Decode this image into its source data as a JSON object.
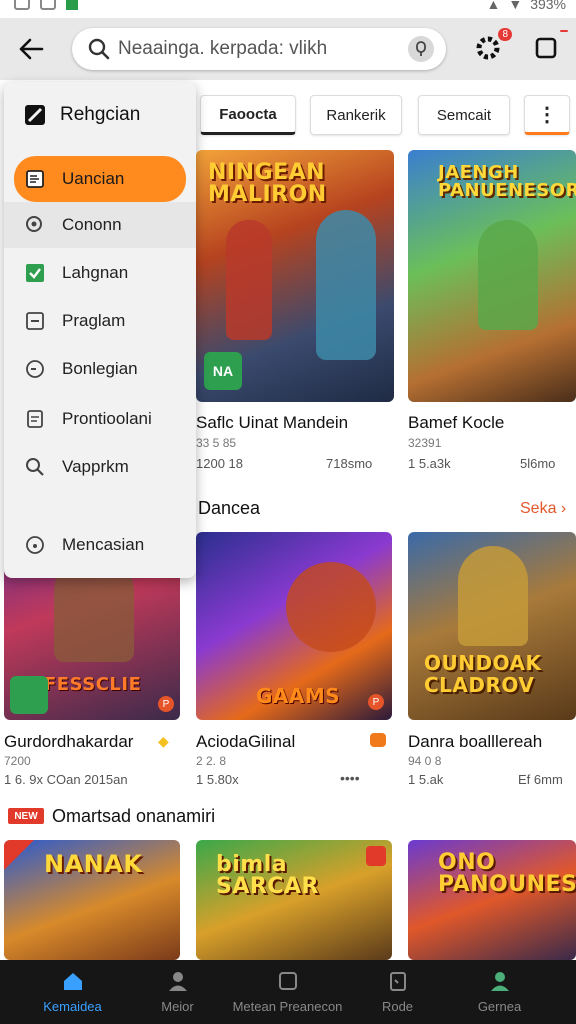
{
  "status_bar": {
    "battery_text": "393%"
  },
  "top_bar": {
    "search_placeholder": "Neaainga. kerpada: vlikh",
    "notif_badge": "8"
  },
  "chips": [
    {
      "label": "Faoocta",
      "active": true
    },
    {
      "label": "Rankerik",
      "active": false
    },
    {
      "label": "Semcait",
      "active": false
    },
    {
      "label": "⋮",
      "active": false
    }
  ],
  "drawer": {
    "title": "Rehgcian",
    "items": [
      {
        "label": "Uancian",
        "icon": "document-icon",
        "state": "active"
      },
      {
        "label": "Cononn",
        "icon": "search-circle-icon",
        "state": "highlight"
      },
      {
        "label": "Lahgnan",
        "icon": "checkbox-icon",
        "state": ""
      },
      {
        "label": "Praglam",
        "icon": "minus-box-icon",
        "state": ""
      },
      {
        "label": "Bonlegian",
        "icon": "clock-icon",
        "state": ""
      },
      {
        "label": "Prontioolani",
        "icon": "file-icon",
        "state": ""
      },
      {
        "label": "Vapprkm",
        "icon": "magnifier-icon",
        "state": ""
      },
      {
        "label": "Mencasian",
        "icon": "info-circle-icon",
        "state": ""
      }
    ]
  },
  "featured": [
    {
      "art_title": "NINGEAN MALIRON",
      "name": "Saflc Uinat Mandein",
      "rating": "33 5 85",
      "downloads": "1200 18",
      "size": "718smo",
      "tag": "NA"
    },
    {
      "art_title": "JAENGH PANUENESORES",
      "name": "Bamef Kocle",
      "rating": "32391",
      "downloads": "1 5.a3k",
      "size": "5l6mo"
    }
  ],
  "section_dancea": {
    "title": "Dancea",
    "see_all": "Seka ›"
  },
  "dancea_games": [
    {
      "art_title": "FESSCLIE",
      "name": "Gurdordhakardar",
      "rating": "7200",
      "downloads": "1 6. 9x  COan 2015an",
      "badge_text": "P"
    },
    {
      "art_title": "GAAMS",
      "name": "AciodaGilinal",
      "rating": "2 2. 8",
      "downloads": "1 5.80x",
      "extra": "••••",
      "badge_text": "P"
    },
    {
      "art_title": "OUNDOAK CLADROV",
      "name": "Danra boalllereah",
      "rating": "94 0 8",
      "downloads": "1 5.ak",
      "size": "Ef 6mm"
    }
  ],
  "section_omart": {
    "badge": "NEW",
    "title": "Omartsad onanamiri"
  },
  "omart_games": [
    {
      "art_title": "NANAK"
    },
    {
      "art_title": "bimla SARCAR"
    },
    {
      "art_title": "ONO PANOUNES"
    }
  ],
  "bottom_nav": [
    {
      "label": "Kemaidea",
      "icon": "home-icon",
      "active": true
    },
    {
      "label": "Meior",
      "icon": "person-icon",
      "active": false
    },
    {
      "label": "Metean Preanecon",
      "icon": "square-icon",
      "active": false
    },
    {
      "label": "Rode",
      "icon": "clipboard-icon",
      "active": false
    },
    {
      "label": "Gernea",
      "icon": "user-icon",
      "active": false
    }
  ]
}
